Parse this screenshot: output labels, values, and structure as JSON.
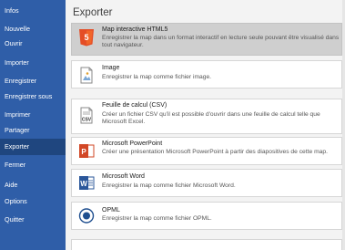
{
  "sidebar": {
    "items": [
      {
        "label": "Infos"
      },
      {
        "label": "Nouvelle"
      },
      {
        "label": "Ouvrir"
      },
      {
        "label": "Importer"
      },
      {
        "label": "Enregistrer"
      },
      {
        "label": "Enregistrer sous"
      },
      {
        "label": "Imprimer"
      },
      {
        "label": "Partager"
      },
      {
        "label": "Exporter",
        "active": true
      },
      {
        "label": "Fermer"
      },
      {
        "label": "Aide"
      },
      {
        "label": "Options"
      },
      {
        "label": "Quitter"
      }
    ]
  },
  "main": {
    "title": "Exporter",
    "options": [
      {
        "icon": "html5-icon",
        "title": "Map interactive HTML5",
        "description": "Enregistrer la map dans un format interactif en lecture seule pouvant être visualisé dans tout navigateur.",
        "selected": true
      },
      {
        "icon": "image-icon",
        "title": "Image",
        "description": "Enregistrer la map comme fichier image."
      },
      {
        "icon": "csv-icon",
        "title": "Feuille de calcul (CSV)",
        "description": "Créer un fichier CSV qu'il est possible d'ouvrir dans une feuille de calcul telle que Microsoft Excel."
      },
      {
        "icon": "powerpoint-icon",
        "title": "Microsoft PowerPoint",
        "description": "Créer une présentation Microsoft PowerPoint à partir des diapositives de cette map."
      },
      {
        "icon": "word-icon",
        "title": "Microsoft Word",
        "description": "Enregistrer la map comme fichier Microsoft Word."
      },
      {
        "icon": "opml-icon",
        "title": "OPML",
        "description": "Enregistrer la map comme fichier OPML."
      }
    ]
  },
  "colors": {
    "sidebar": "#2f5ea8",
    "sidebar_active": "#1f467f",
    "selected_option": "#cfcfcf",
    "html5": "#e44d26",
    "powerpoint": "#d24726",
    "word": "#2b579a",
    "opml": "#1f4f8f"
  }
}
